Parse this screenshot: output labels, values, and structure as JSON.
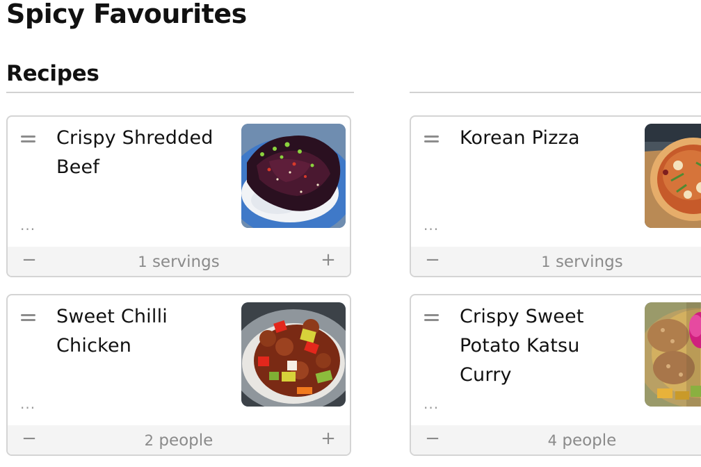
{
  "page": {
    "title": "Spicy Favourites",
    "section_title": "Recipes"
  },
  "recipes": [
    {
      "name": "Crispy Shredded Beef",
      "quantity": "1",
      "unit": "servings",
      "more_label": "...",
      "image": "crispy-shredded-beef-photo"
    },
    {
      "name": "Korean Pizza",
      "quantity": "1",
      "unit": "servings",
      "more_label": "...",
      "image": "korean-pizza-photo"
    },
    {
      "name": "Sweet Chilli Chicken",
      "quantity": "2",
      "unit": "people",
      "more_label": "...",
      "image": "sweet-chilli-chicken-photo"
    },
    {
      "name": "Crispy Sweet Potato Katsu Curry",
      "quantity": "4",
      "unit": "people",
      "more_label": "...",
      "image": "katsu-curry-photo"
    }
  ],
  "controls": {
    "minus_symbol": "−",
    "plus_symbol": "+"
  },
  "icons": {
    "drag": "drag-handle-icon",
    "more": "more-options-icon",
    "minus": "minus-icon",
    "plus": "plus-icon"
  },
  "colors": {
    "card_border": "#d4d4d4",
    "footer_bg": "#f4f4f4",
    "muted_text": "#8a8a8a"
  }
}
